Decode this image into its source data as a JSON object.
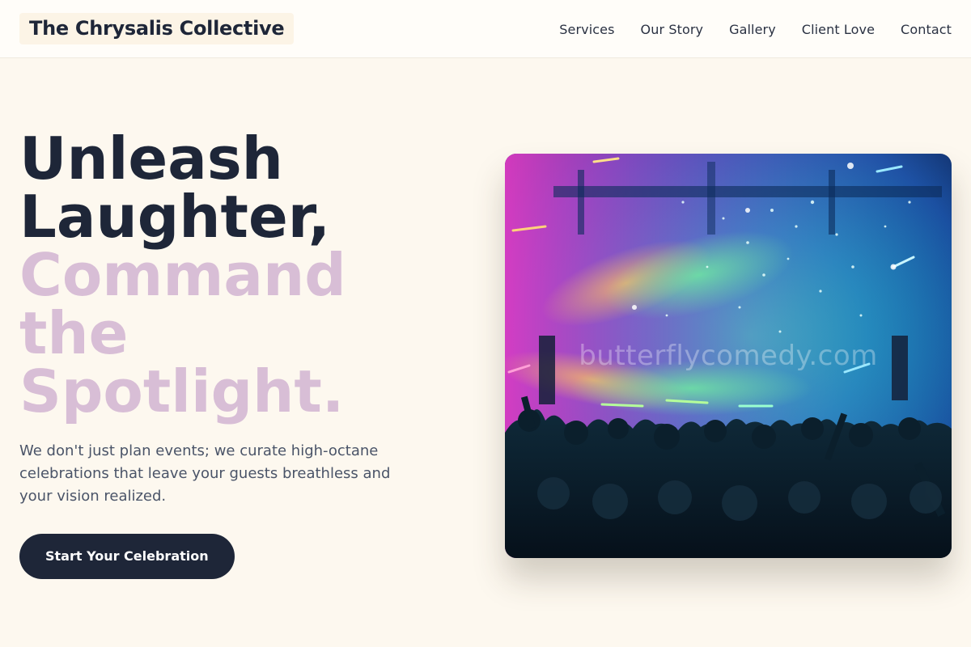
{
  "header": {
    "brand": "The Chrysalis Collective",
    "nav": [
      {
        "label": "Services"
      },
      {
        "label": "Our Story"
      },
      {
        "label": "Gallery"
      },
      {
        "label": "Client Love"
      },
      {
        "label": "Contact"
      }
    ]
  },
  "hero": {
    "headline_dark": [
      "Unleash",
      "Laughter,"
    ],
    "headline_accent": [
      "Command",
      "the",
      "Spotlight."
    ],
    "subtext": "We don't just plan events; we curate high-octane celebrations that leave your guests breathless and your vision realized.",
    "cta_label": "Start Your Celebration",
    "image_watermark": "butterflycomedy.com"
  },
  "colors": {
    "background": "#fdf8ef",
    "dark": "#1e2638",
    "accent": "#d8bed6"
  }
}
